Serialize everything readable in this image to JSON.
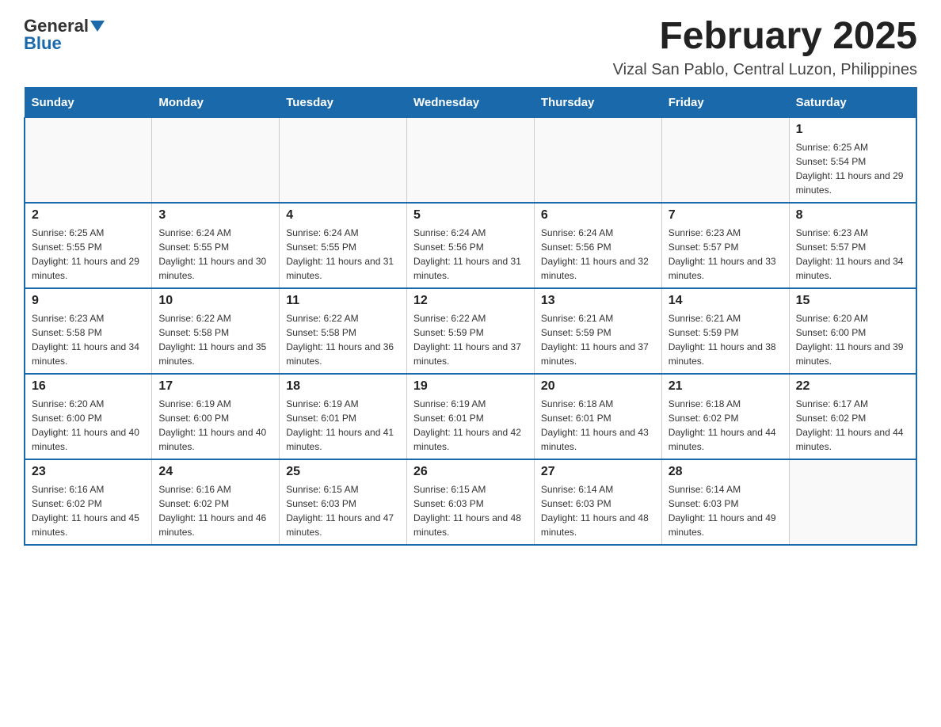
{
  "logo": {
    "general": "General",
    "blue": "Blue"
  },
  "title": "February 2025",
  "subtitle": "Vizal San Pablo, Central Luzon, Philippines",
  "weekdays": [
    "Sunday",
    "Monday",
    "Tuesday",
    "Wednesday",
    "Thursday",
    "Friday",
    "Saturday"
  ],
  "weeks": [
    [
      {
        "day": "",
        "info": ""
      },
      {
        "day": "",
        "info": ""
      },
      {
        "day": "",
        "info": ""
      },
      {
        "day": "",
        "info": ""
      },
      {
        "day": "",
        "info": ""
      },
      {
        "day": "",
        "info": ""
      },
      {
        "day": "1",
        "info": "Sunrise: 6:25 AM\nSunset: 5:54 PM\nDaylight: 11 hours and 29 minutes."
      }
    ],
    [
      {
        "day": "2",
        "info": "Sunrise: 6:25 AM\nSunset: 5:55 PM\nDaylight: 11 hours and 29 minutes."
      },
      {
        "day": "3",
        "info": "Sunrise: 6:24 AM\nSunset: 5:55 PM\nDaylight: 11 hours and 30 minutes."
      },
      {
        "day": "4",
        "info": "Sunrise: 6:24 AM\nSunset: 5:55 PM\nDaylight: 11 hours and 31 minutes."
      },
      {
        "day": "5",
        "info": "Sunrise: 6:24 AM\nSunset: 5:56 PM\nDaylight: 11 hours and 31 minutes."
      },
      {
        "day": "6",
        "info": "Sunrise: 6:24 AM\nSunset: 5:56 PM\nDaylight: 11 hours and 32 minutes."
      },
      {
        "day": "7",
        "info": "Sunrise: 6:23 AM\nSunset: 5:57 PM\nDaylight: 11 hours and 33 minutes."
      },
      {
        "day": "8",
        "info": "Sunrise: 6:23 AM\nSunset: 5:57 PM\nDaylight: 11 hours and 34 minutes."
      }
    ],
    [
      {
        "day": "9",
        "info": "Sunrise: 6:23 AM\nSunset: 5:58 PM\nDaylight: 11 hours and 34 minutes."
      },
      {
        "day": "10",
        "info": "Sunrise: 6:22 AM\nSunset: 5:58 PM\nDaylight: 11 hours and 35 minutes."
      },
      {
        "day": "11",
        "info": "Sunrise: 6:22 AM\nSunset: 5:58 PM\nDaylight: 11 hours and 36 minutes."
      },
      {
        "day": "12",
        "info": "Sunrise: 6:22 AM\nSunset: 5:59 PM\nDaylight: 11 hours and 37 minutes."
      },
      {
        "day": "13",
        "info": "Sunrise: 6:21 AM\nSunset: 5:59 PM\nDaylight: 11 hours and 37 minutes."
      },
      {
        "day": "14",
        "info": "Sunrise: 6:21 AM\nSunset: 5:59 PM\nDaylight: 11 hours and 38 minutes."
      },
      {
        "day": "15",
        "info": "Sunrise: 6:20 AM\nSunset: 6:00 PM\nDaylight: 11 hours and 39 minutes."
      }
    ],
    [
      {
        "day": "16",
        "info": "Sunrise: 6:20 AM\nSunset: 6:00 PM\nDaylight: 11 hours and 40 minutes."
      },
      {
        "day": "17",
        "info": "Sunrise: 6:19 AM\nSunset: 6:00 PM\nDaylight: 11 hours and 40 minutes."
      },
      {
        "day": "18",
        "info": "Sunrise: 6:19 AM\nSunset: 6:01 PM\nDaylight: 11 hours and 41 minutes."
      },
      {
        "day": "19",
        "info": "Sunrise: 6:19 AM\nSunset: 6:01 PM\nDaylight: 11 hours and 42 minutes."
      },
      {
        "day": "20",
        "info": "Sunrise: 6:18 AM\nSunset: 6:01 PM\nDaylight: 11 hours and 43 minutes."
      },
      {
        "day": "21",
        "info": "Sunrise: 6:18 AM\nSunset: 6:02 PM\nDaylight: 11 hours and 44 minutes."
      },
      {
        "day": "22",
        "info": "Sunrise: 6:17 AM\nSunset: 6:02 PM\nDaylight: 11 hours and 44 minutes."
      }
    ],
    [
      {
        "day": "23",
        "info": "Sunrise: 6:16 AM\nSunset: 6:02 PM\nDaylight: 11 hours and 45 minutes."
      },
      {
        "day": "24",
        "info": "Sunrise: 6:16 AM\nSunset: 6:02 PM\nDaylight: 11 hours and 46 minutes."
      },
      {
        "day": "25",
        "info": "Sunrise: 6:15 AM\nSunset: 6:03 PM\nDaylight: 11 hours and 47 minutes."
      },
      {
        "day": "26",
        "info": "Sunrise: 6:15 AM\nSunset: 6:03 PM\nDaylight: 11 hours and 48 minutes."
      },
      {
        "day": "27",
        "info": "Sunrise: 6:14 AM\nSunset: 6:03 PM\nDaylight: 11 hours and 48 minutes."
      },
      {
        "day": "28",
        "info": "Sunrise: 6:14 AM\nSunset: 6:03 PM\nDaylight: 11 hours and 49 minutes."
      },
      {
        "day": "",
        "info": ""
      }
    ]
  ]
}
